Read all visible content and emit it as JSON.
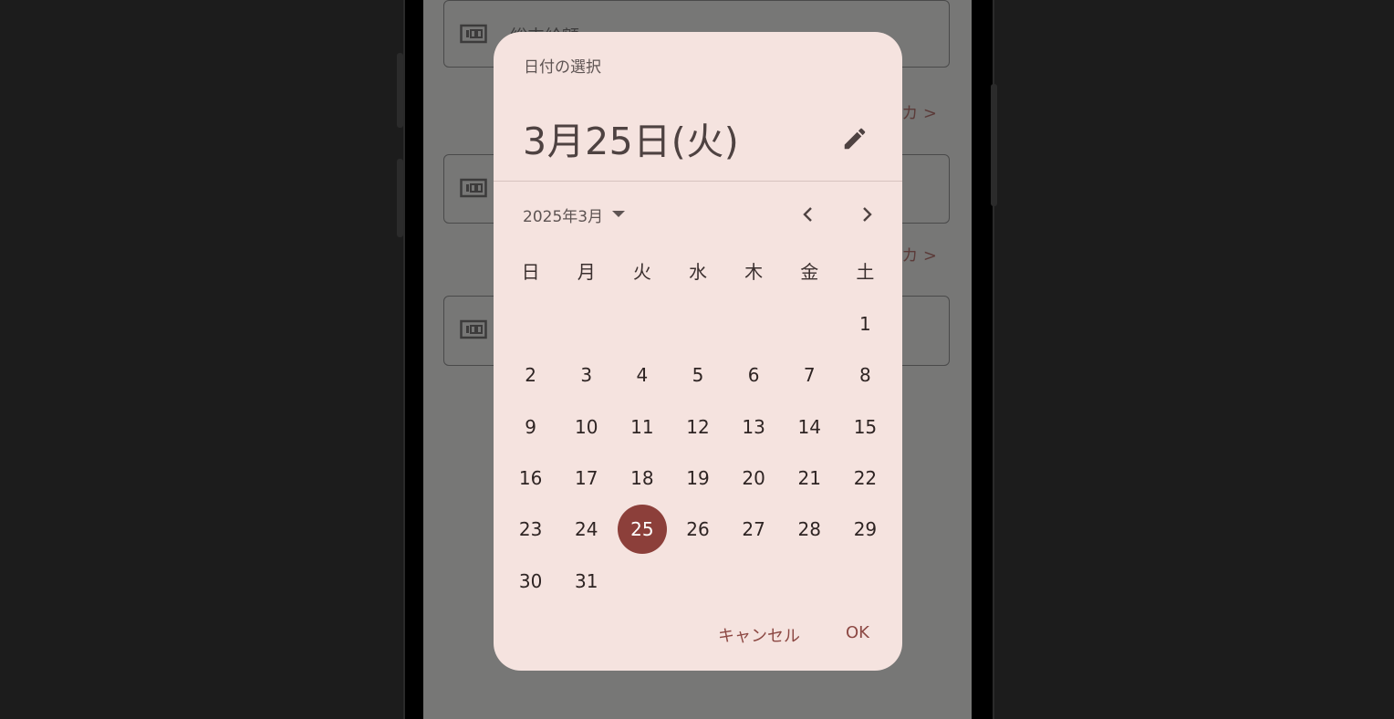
{
  "background_form": {
    "field1_label": "総支給額",
    "link1_text": "カ >",
    "link2_text": "カ >"
  },
  "dialog": {
    "title": "日付の選択",
    "headline": "3月25日(火)",
    "month_label": "2025年3月",
    "weekdays": [
      "日",
      "月",
      "火",
      "水",
      "木",
      "金",
      "土"
    ],
    "days": [
      "",
      "",
      "",
      "",
      "",
      "",
      "1",
      "2",
      "3",
      "4",
      "5",
      "6",
      "7",
      "8",
      "9",
      "10",
      "11",
      "12",
      "13",
      "14",
      "15",
      "16",
      "17",
      "18",
      "19",
      "20",
      "21",
      "22",
      "23",
      "24",
      "25",
      "26",
      "27",
      "28",
      "29",
      "30",
      "31",
      "",
      "",
      "",
      "",
      ""
    ],
    "selected_day": "25",
    "cancel_label": "キャンセル",
    "ok_label": "OK"
  },
  "colors": {
    "accent": "#8c3f3a",
    "dialog_bg": "#f5e3df",
    "scrim": "#777776"
  },
  "icons": [
    "edit-pencil-icon",
    "dropdown-arrow-icon",
    "chevron-left-icon",
    "chevron-right-icon",
    "money-icon"
  ]
}
